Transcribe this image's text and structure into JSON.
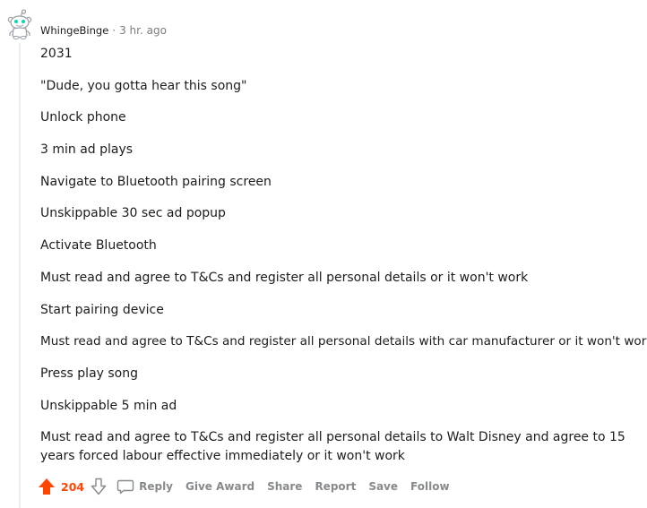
{
  "comment": {
    "username": "WhingeBinge",
    "separator": "·",
    "timestamp": "3 hr. ago",
    "lines": [
      "2031",
      "\"Dude, you gotta hear this song\"",
      "Unlock phone",
      "3 min ad plays",
      "Navigate to Bluetooth pairing screen",
      "Unskippable 30 sec ad popup",
      "Activate Bluetooth",
      "Must read and agree to T&Cs and register all personal details or it won't work",
      "Start pairing device",
      "Must read and agree to T&Cs and register all personal details with car manufacturer or it won't work",
      "Press play song",
      "Unskippable 5 min ad",
      "Must read and agree to T&Cs and register all personal details to Walt Disney and agree to 15 years forced labour effective immediately or it won't work"
    ]
  },
  "actions": {
    "score": "204",
    "reply": "Reply",
    "give_award": "Give Award",
    "share": "Share",
    "report": "Report",
    "save": "Save",
    "follow": "Follow"
  },
  "colors": {
    "upvote": "#ff4500",
    "meta_text": "#878a8c",
    "thread_line": "#edeff1"
  },
  "icons": {
    "avatar": "snoo-avatar-icon",
    "upvote": "upvote-arrow-icon",
    "downvote": "downvote-arrow-icon",
    "reply": "comment-bubble-icon"
  }
}
